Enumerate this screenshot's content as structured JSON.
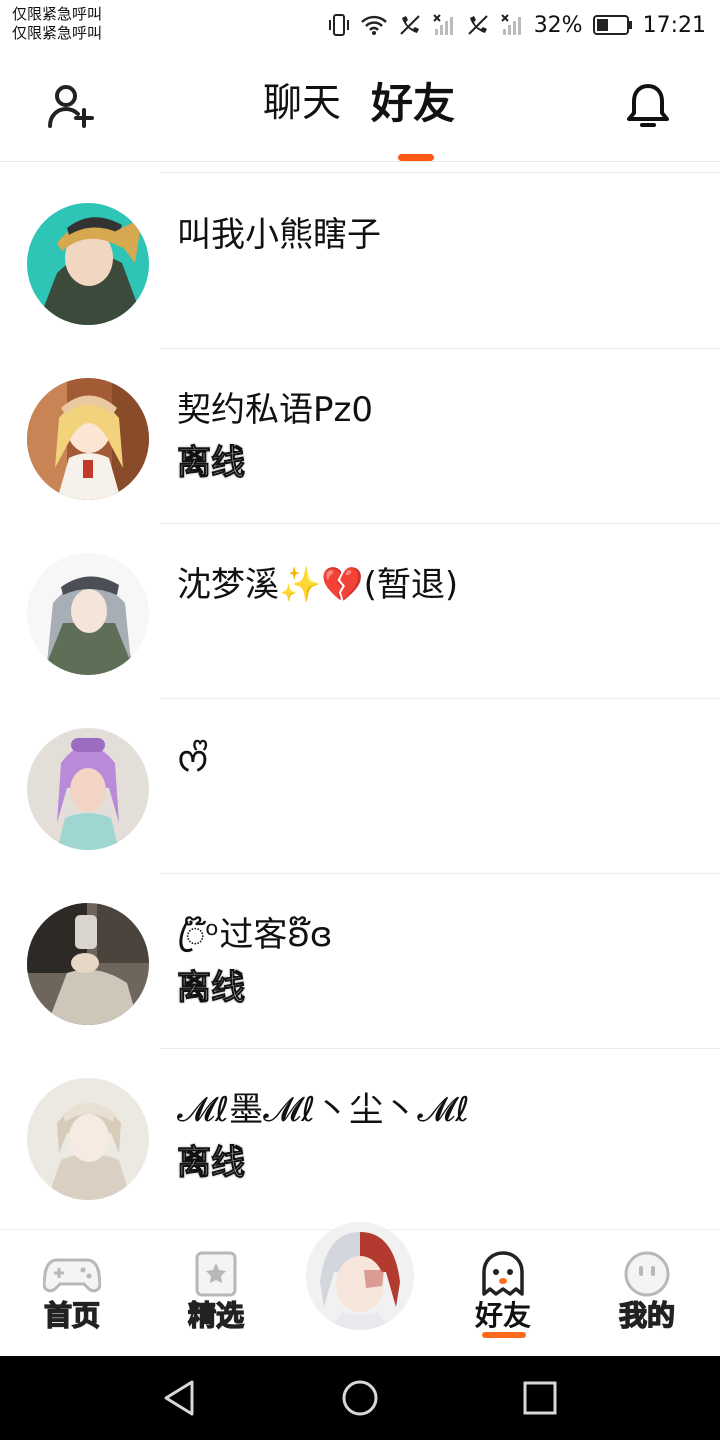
{
  "status_bar": {
    "carrier_line1": "仅限紧急呼叫",
    "carrier_line2": "仅限紧急呼叫",
    "battery": "32%",
    "time": "17:21",
    "icons": [
      "vibrate-icon",
      "wifi-icon",
      "no-call-icon",
      "no-signal-icon",
      "no-call-icon",
      "no-signal-icon",
      "battery-icon"
    ]
  },
  "header": {
    "tab_chat": "聊天",
    "tab_friends": "好友",
    "active_tab": "好友",
    "accent": "#ff5a14"
  },
  "friends": [
    {
      "name": "叫我小熊瞎子",
      "status": "",
      "avatar_colors": [
        "#2ec4b6",
        "#d6a84f",
        "#3a3a3a"
      ]
    },
    {
      "name": "契约私语Pz0",
      "status": "离线",
      "avatar_colors": [
        "#e8c9a0",
        "#f2d27a",
        "#8a4b2a"
      ]
    },
    {
      "name": "沈梦溪✨💔(暂退)",
      "status": "",
      "avatar_colors": [
        "#f4f4f4",
        "#6e7b6a",
        "#9aa0a8"
      ]
    },
    {
      "name": "ᰔᩚ",
      "status": "",
      "avatar_colors": [
        "#e7e3dc",
        "#b98ad8",
        "#f3d4c4"
      ]
    },
    {
      "name": "ꦿ໊ᵒ过客ʚ໊ɞ",
      "status": "离线",
      "avatar_colors": [
        "#2d2a26",
        "#8c8378",
        "#cfc6ba"
      ]
    },
    {
      "name": "𝓜ℓ墨𝓜ℓ丶尘丶𝓜ℓ",
      "status": "离线",
      "avatar_colors": [
        "#efece6",
        "#d9cfc2",
        "#b8a894"
      ]
    }
  ],
  "bottom_nav": {
    "items": [
      {
        "label": "首页",
        "icon": "gamepad-icon"
      },
      {
        "label": "精选",
        "icon": "star-bookmark-icon"
      },
      {
        "label": "好友",
        "icon": "ghost-icon"
      },
      {
        "label": "我的",
        "icon": "face-icon"
      }
    ],
    "active": "好友",
    "center_avatar_colors": [
      "#f2f2f2",
      "#b23a2e",
      "#cfd3d9"
    ]
  }
}
